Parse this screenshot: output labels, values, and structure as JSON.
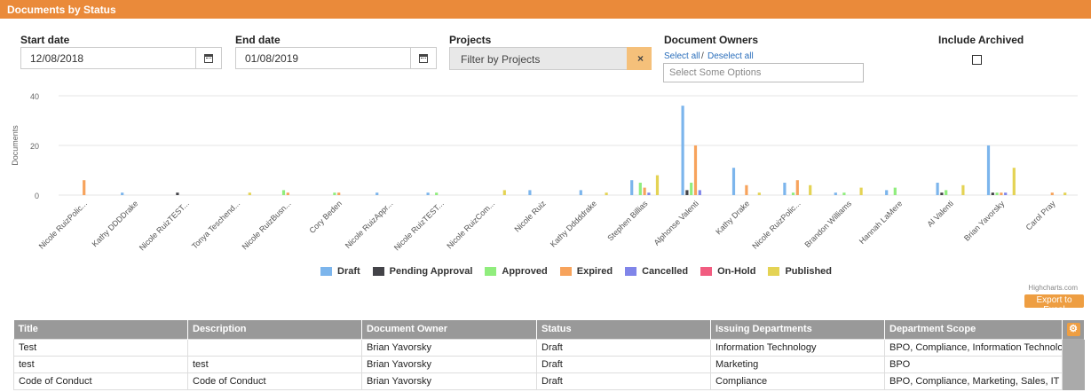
{
  "header": {
    "title": "Documents by Status"
  },
  "filters": {
    "start_date": {
      "label": "Start date",
      "value": "12/08/2018"
    },
    "end_date": {
      "label": "End date",
      "value": "01/08/2019"
    },
    "projects": {
      "label": "Projects",
      "placeholder": "Filter by Projects",
      "clear_icon": "×"
    },
    "owners": {
      "label": "Document Owners",
      "select_all": "Select all",
      "separator": "/",
      "deselect_all": "Deselect all",
      "placeholder": "Select Some Options"
    },
    "archived": {
      "label": "Include Archived",
      "checked": false
    }
  },
  "chart_data": {
    "type": "bar",
    "ylabel": "Documents",
    "xlabel": "",
    "ylim": [
      0,
      40
    ],
    "yticks": [
      0,
      20,
      40
    ],
    "grid": true,
    "legend": "bottom",
    "categories": [
      "Nicole RuizPolic...",
      "Kathy DDDDrake",
      "Nicole RuizTEST...",
      "Tonya Teschend...",
      "Nicole RuizBusn...",
      "Cory Beden",
      "Nicole RuizAppr...",
      "Nicole RuizTEST...",
      "Nicole RuizCom...",
      "Nicole Ruiz",
      "Kathy Dddddrake",
      "Stephen Billias",
      "Alphonse Valenti",
      "Kathy Drake",
      "Nicole RuizPolic...",
      "Brandon Williams",
      "Hannah LaMere",
      "Al Valenti",
      "Brian Yavorsky",
      "Carol Pray"
    ],
    "series": [
      {
        "name": "Draft",
        "color": "#7cb5ec",
        "values": [
          0,
          1,
          0,
          0,
          0,
          0,
          1,
          1,
          0,
          2,
          2,
          6,
          36,
          11,
          5,
          1,
          2,
          5,
          20,
          0
        ]
      },
      {
        "name": "Pending Approval",
        "color": "#434348",
        "values": [
          0,
          0,
          1,
          0,
          0,
          0,
          0,
          0,
          0,
          0,
          0,
          0,
          2,
          0,
          0,
          0,
          0,
          1,
          1,
          0
        ]
      },
      {
        "name": "Approved",
        "color": "#90ed7d",
        "values": [
          0,
          0,
          0,
          0,
          2,
          1,
          0,
          1,
          0,
          0,
          0,
          5,
          5,
          0,
          1,
          1,
          3,
          2,
          1,
          0
        ]
      },
      {
        "name": "Expired",
        "color": "#f7a35c",
        "values": [
          6,
          0,
          0,
          0,
          1,
          1,
          0,
          0,
          0,
          0,
          0,
          3,
          20,
          4,
          6,
          0,
          0,
          0,
          1,
          1
        ]
      },
      {
        "name": "Cancelled",
        "color": "#8085e9",
        "values": [
          0,
          0,
          0,
          0,
          0,
          0,
          0,
          0,
          0,
          0,
          0,
          1,
          2,
          0,
          0,
          0,
          0,
          0,
          1,
          0
        ]
      },
      {
        "name": "On-Hold",
        "color": "#f15c80",
        "values": [
          0,
          0,
          0,
          0,
          0,
          0,
          0,
          0,
          0,
          0,
          0,
          0,
          0,
          0,
          0,
          0,
          0,
          0,
          0,
          0
        ]
      },
      {
        "name": "Published",
        "color": "#e4d354",
        "values": [
          0,
          0,
          0,
          1,
          0,
          0,
          0,
          0,
          2,
          0,
          1,
          8,
          0,
          1,
          4,
          3,
          0,
          4,
          11,
          1
        ]
      }
    ],
    "credit": "Highcharts.com"
  },
  "export_label": "Export to Excel",
  "table": {
    "columns": [
      "Title",
      "Description",
      "Document Owner",
      "Status",
      "Issuing Departments",
      "Department Scope"
    ],
    "gear_icon": "⚙",
    "rows": [
      [
        "Test",
        "",
        "Brian Yavorsky",
        "Draft",
        "Information Technology",
        "BPO, Compliance, Information Technolo"
      ],
      [
        "test",
        "test",
        "Brian Yavorsky",
        "Draft",
        "Marketing",
        "BPO"
      ],
      [
        "Code of Conduct",
        "Code of Conduct",
        "Brian Yavorsky",
        "Draft",
        "Compliance",
        "BPO, Compliance, Marketing, Sales, IT"
      ]
    ]
  }
}
